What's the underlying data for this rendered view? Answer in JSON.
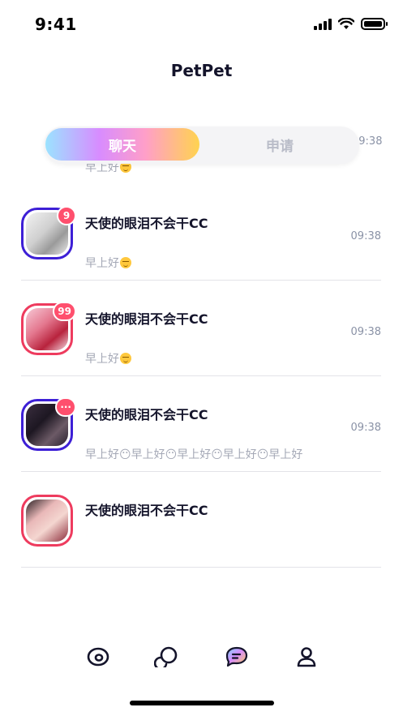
{
  "status_bar": {
    "time": "9:41"
  },
  "header": {
    "title": "PetPet"
  },
  "segment": {
    "active_label": "聊天",
    "inactive_label": "申请"
  },
  "partial_item": {
    "time": "09:38",
    "preview": "早上好"
  },
  "messages": [
    {
      "name": "天使的眼泪不会干CC",
      "time": "09:38",
      "preview": "早上好",
      "badge": "9",
      "border_color": "#3d1fd6"
    },
    {
      "name": "天使的眼泪不会干CC",
      "time": "09:38",
      "preview": "早上好",
      "badge": "99",
      "border_color": "#ee3b5e"
    },
    {
      "name": "天使的眼泪不会干CC",
      "time": "09:38",
      "preview": "早上好😶早上好😶早上好😶早上好😶早上好",
      "badge": "···",
      "border_color": "#3d1fd6"
    },
    {
      "name": "天使的眼泪不会干CC",
      "time": "",
      "preview": "",
      "badge": "",
      "border_color": "#ee3b5e"
    }
  ],
  "tabs": [
    {
      "icon": "eye-icon"
    },
    {
      "icon": "bubbles-icon"
    },
    {
      "icon": "chat-icon"
    },
    {
      "icon": "profile-icon"
    }
  ]
}
